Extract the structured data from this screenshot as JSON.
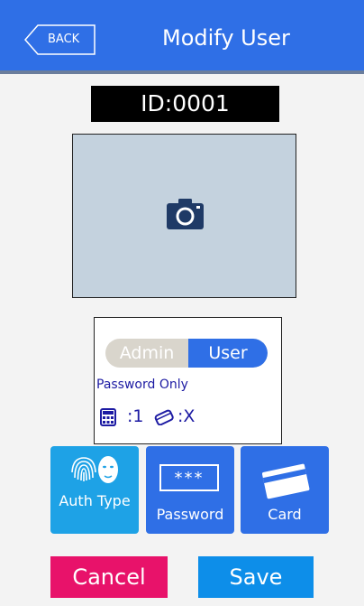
{
  "header": {
    "back_label": "BACK",
    "title": "Modify User"
  },
  "user": {
    "id_label": "ID:0001"
  },
  "photo": {
    "icon": "camera-icon"
  },
  "role_toggle": {
    "options": [
      "Admin",
      "User"
    ],
    "selected": "User"
  },
  "auth": {
    "mode_label": "Password Only",
    "password_count": ":1",
    "card_count": ":X"
  },
  "tiles": {
    "auth_type_label": "Auth Type",
    "password_label": "Password",
    "password_mask": "***",
    "card_label": "Card"
  },
  "actions": {
    "cancel_label": "Cancel",
    "save_label": "Save"
  },
  "colors": {
    "header": "#2f6fe6",
    "cancel": "#e8126a",
    "save": "#0d8ee9",
    "auth_tile": "#1ea2e6",
    "text_blue": "#1d1ba3"
  }
}
